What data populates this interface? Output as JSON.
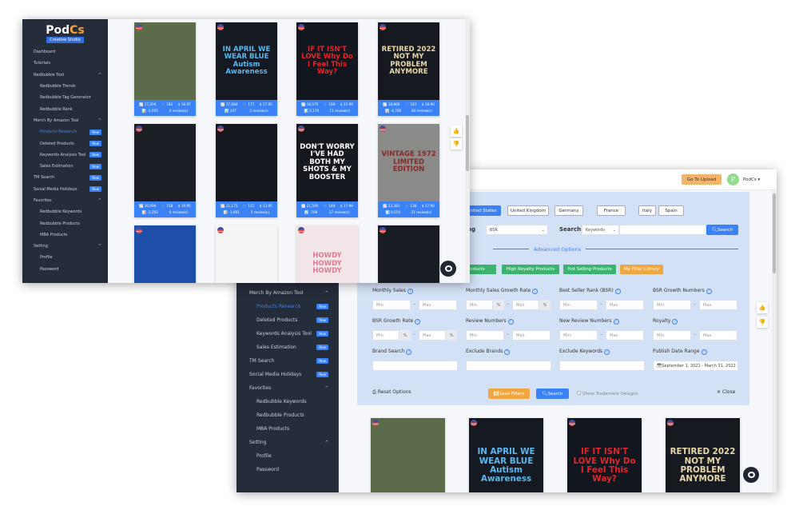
{
  "brand": {
    "name": "Pod",
    "name_accent": "Cs",
    "tagline": "Creative Studio"
  },
  "sidebar": [
    {
      "label": "Dashboard",
      "level": 0
    },
    {
      "label": "Tutorials",
      "level": 0
    },
    {
      "label": "Redbubble Tool",
      "level": 0,
      "chevron": "^"
    },
    {
      "label": "Redbubble Trends",
      "level": 1
    },
    {
      "label": "Redbubble Tag Generator",
      "level": 1
    },
    {
      "label": "Redbubble Rank",
      "level": 1
    },
    {
      "label": "Merch By Amazon Tool",
      "level": 0,
      "chevron": "^"
    },
    {
      "label": "Products Research",
      "level": 1,
      "badge": "New",
      "active": true
    },
    {
      "label": "Deleted Products",
      "level": 1,
      "badge": "New"
    },
    {
      "label": "Keywords Analysis Tool",
      "level": 1,
      "badge": "New"
    },
    {
      "label": "Sales Estimation",
      "level": 1,
      "badge": "New"
    },
    {
      "label": "TM Search",
      "level": 0,
      "badge": "New"
    },
    {
      "label": "Social Media Holidays",
      "level": 0,
      "badge": "New"
    },
    {
      "label": "Favorites",
      "level": 0,
      "chevron": "^"
    },
    {
      "label": "Redbubble Keywords",
      "level": 1
    },
    {
      "label": "Redbubble Products",
      "level": 1
    },
    {
      "label": "MBA Products",
      "level": 1
    },
    {
      "label": "Setting",
      "level": 0,
      "chevron": "^"
    },
    {
      "label": "Profile",
      "level": 1
    },
    {
      "label": "Password",
      "level": 1
    }
  ],
  "products": [
    {
      "design": "",
      "bg": "#5c6b4a",
      "fg": "#333",
      "bsr": "17,204",
      "sales": "181",
      "price": "$ 16.97",
      "change": "-2,955",
      "reviews": "4 review(s)"
    },
    {
      "design": "IN APRIL WE WEAR BLUE Autism Awareness",
      "bg": "#151a22",
      "fg": "#5ab8f0",
      "bsr": "17,684",
      "sales": "177",
      "price": "$ 17.95",
      "change": "247",
      "reviews": "2 review(s)"
    },
    {
      "design": "IF IT ISN'T LOVE Why Do I Feel This Way?",
      "bg": "#12161e",
      "fg": "#e3252a",
      "bsr": "18,575",
      "sales": "169",
      "price": "$ 15.99",
      "change": "2,170",
      "reviews": "11 review(s)"
    },
    {
      "design": "RETIRED 2022 NOT MY PROBLEM ANYMORE",
      "bg": "#161a20",
      "fg": "#e8d7a8",
      "bsr": "18,866",
      "sales": "167",
      "price": "$ 18.90",
      "change": "-4,780",
      "reviews": "46 review(s)"
    },
    {
      "design": "",
      "bg": "#1b1e24",
      "fg": "#f5d21c",
      "bsr": "20,094",
      "sales": "158",
      "price": "$ 19.95",
      "change": "-2,292",
      "reviews": "0 review(s)"
    },
    {
      "design": "",
      "bg": "#15181e",
      "fg": "#f2b8c0",
      "bsr": "21,175",
      "sales": "151",
      "price": "$ 13.95",
      "change": "-1,691",
      "reviews": "5 review(s)"
    },
    {
      "design": "DON'T WORRY I'VE HAD BOTH MY SHOTS & MY BOOSTER",
      "bg": "#15181e",
      "fg": "#fff",
      "bsr": "21,595",
      "sales": "148",
      "price": "$ 17.99",
      "change": "-769",
      "reviews": "37 review(s)"
    },
    {
      "design": "VINTAGE 1972 LIMITED EDITION",
      "bg": "#8a8a88",
      "fg": "#8b2a2a",
      "bsr": "23,381",
      "sales": "136",
      "price": "$ 17.90",
      "change": "8,554",
      "reviews": "21 review(s)"
    },
    {
      "design": "",
      "bg": "#1d4fa8",
      "fg": "#f5d21c"
    },
    {
      "design": "",
      "bg": "#f4f4f4",
      "fg": "#333"
    },
    {
      "design": "HOWDY HOWDY HOWDY",
      "bg": "#f3e6e8",
      "fg": "#e07b93"
    },
    {
      "design": "",
      "bg": "#1a1d24",
      "fg": "#f2c21c"
    }
  ],
  "header": {
    "upload_button": "Go To Upload",
    "avatar_letter": "P",
    "user": "PodCs",
    "accent": "#f2b36a"
  },
  "filters": {
    "countries": [
      "United States",
      "United Kingdom",
      "Germany",
      "France",
      "Italy",
      "Spain"
    ],
    "sorting_label": "Sorting",
    "sorting_value": "BSR",
    "search_label": "Search",
    "search_type": "Keywords",
    "search_button": "Search",
    "advanced_label": "Advanced Options",
    "presets": [
      "Special Products",
      "High Royalty Products",
      "Hot Selling Products",
      "My Filter Library"
    ],
    "fields": [
      {
        "label": "Monthly Sales",
        "type": "range"
      },
      {
        "label": "Monthly Sales Growth Rate",
        "type": "pct"
      },
      {
        "label": "Best Seller Rank (BSR)",
        "type": "range"
      },
      {
        "label": "BSR Growth Numbers",
        "type": "range"
      },
      {
        "label": "BSR Growth Rate",
        "type": "pct"
      },
      {
        "label": "Review Numbers",
        "type": "range"
      },
      {
        "label": "New Review Numbers",
        "type": "range"
      },
      {
        "label": "Royalty",
        "type": "range"
      },
      {
        "label": "Brand Search",
        "type": "text"
      },
      {
        "label": "Exclude Brands",
        "type": "text"
      },
      {
        "label": "Exclude Keywords",
        "type": "text"
      },
      {
        "label": "Publish Date Range",
        "type": "date",
        "value": "September 1, 2021 - March 31, 2022"
      }
    ],
    "min_placeholder": "Min.",
    "max_placeholder": "Max.",
    "pct": "%",
    "reset": "Reset Options",
    "save": "Save Filters",
    "search": "Search",
    "trademark": "Show Trademark Designs",
    "close": "Close"
  },
  "colors": {
    "sidebar": "#252c3a",
    "primary": "#3b82f6",
    "green": "#3cb371",
    "orange": "#f0a742",
    "panel": "#d3e1f6"
  }
}
